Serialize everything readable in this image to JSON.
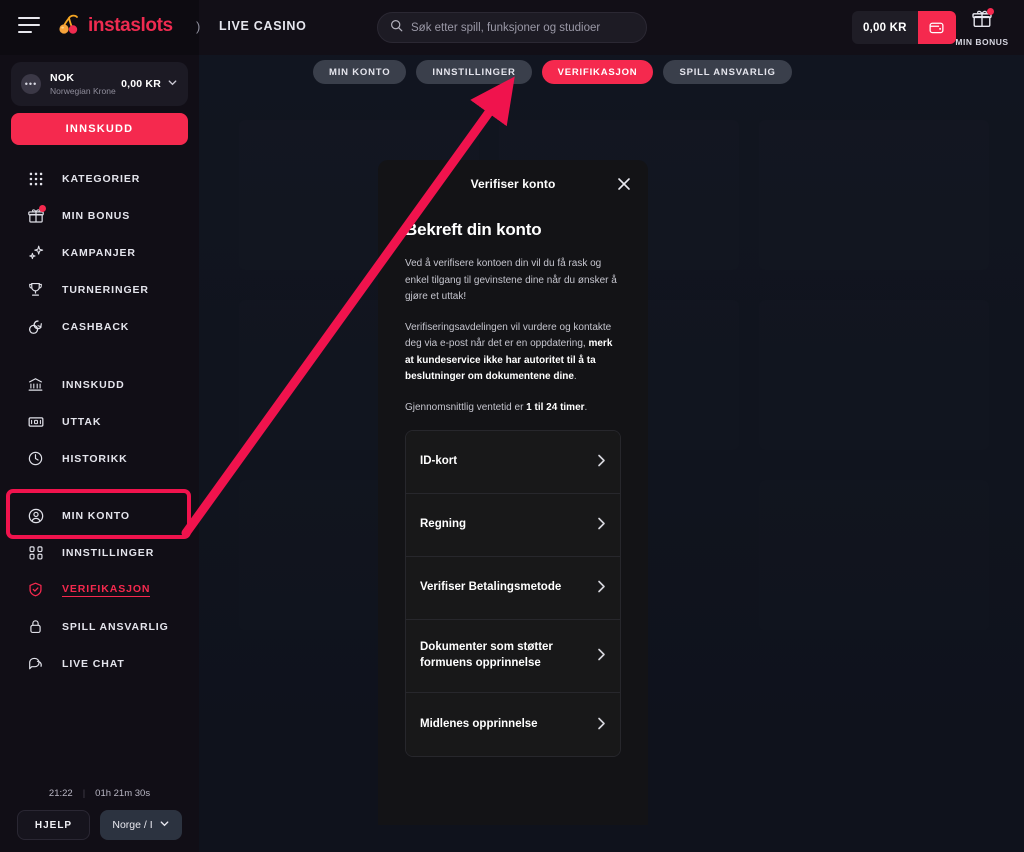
{
  "brand": {
    "name": "instaslots",
    "accent": "#f5294e"
  },
  "topbar": {
    "nav_cut_glyph": ")",
    "live_casino_label": "LIVE CASINO",
    "search": {
      "placeholder": "Søk etter spill, funksjoner og studioer",
      "value": "",
      "icon": "search-icon"
    },
    "balance": {
      "amount": "0,00 KR",
      "wallet_icon": "wallet-icon"
    },
    "bonus": {
      "label": "MIN BONUS",
      "icon": "gift-icon",
      "has_notification": true
    }
  },
  "sidebar": {
    "currency": {
      "code": "NOK",
      "name": "Norwegian Krone",
      "amount": "0,00 KR",
      "chevron": "chevron-down-icon"
    },
    "deposit_label": "INNSKUDD",
    "group1": [
      {
        "label": "KATEGORIER",
        "icon": "grid-icon"
      },
      {
        "label": "MIN BONUS",
        "icon": "gift-icon",
        "badge": true
      },
      {
        "label": "KAMPANJER",
        "icon": "sparkles-icon"
      },
      {
        "label": "TURNERINGER",
        "icon": "trophy-icon"
      },
      {
        "label": "CASHBACK",
        "icon": "cashback-icon"
      }
    ],
    "group2": [
      {
        "label": "INNSKUDD",
        "icon": "bank-icon"
      },
      {
        "label": "UTTAK",
        "icon": "banknote-icon"
      },
      {
        "label": "HISTORIKK",
        "icon": "clock-icon"
      }
    ],
    "group3": [
      {
        "label": "MIN KONTO",
        "icon": "user-circle-icon",
        "highlighted": true
      },
      {
        "label": "INNSTILLINGER",
        "icon": "sliders-icon"
      },
      {
        "label": "VERIFIKASJON",
        "icon": "shield-check-icon",
        "active": true
      },
      {
        "label": "SPILL ANSVARLIG",
        "icon": "lock-icon"
      },
      {
        "label": "LIVE CHAT",
        "icon": "chat-icon"
      }
    ],
    "footer": {
      "clock": "21:22",
      "session": "01h 21m 30s",
      "help_label": "HJELP",
      "language_label": "Norge / I",
      "language_chevron": "chevron-down-icon"
    }
  },
  "tabs": [
    {
      "label": "MIN KONTO",
      "active": false
    },
    {
      "label": "INNSTILLINGER",
      "active": false
    },
    {
      "label": "VERIFIKASJON",
      "active": true
    },
    {
      "label": "SPILL ANSVARLIG",
      "active": false
    }
  ],
  "modal": {
    "title": "Verifiser konto",
    "close_icon": "close-icon",
    "heading": "Bekreft din konto",
    "paragraph1": "Ved å verifisere kontoen din vil du få rask og enkel tilgang til gevinstene dine når du ønsker å gjøre et uttak!",
    "paragraph2_pre": "Verifiseringsavdelingen vil vurdere og kontakte deg via e-post når det er en oppdatering, ",
    "paragraph2_bold": "merk at kundeservice ikke har autoritet til å ta beslutninger om dokumentene dine",
    "paragraph2_post": ".",
    "paragraph3_pre": "Gjennomsnittlig ventetid er ",
    "paragraph3_bold": "1 til 24 timer",
    "paragraph3_post": ".",
    "documents": [
      {
        "label": "ID-kort",
        "chevron": "chevron-right-icon"
      },
      {
        "label": "Regning",
        "chevron": "chevron-right-icon"
      },
      {
        "label": "Verifiser Betalingsmetode",
        "chevron": "chevron-right-icon"
      },
      {
        "label": "Dokumenter som støtter formuens opprinnelse",
        "chevron": "chevron-right-icon"
      },
      {
        "label": "Midlenes opprinnelse",
        "chevron": "chevron-right-icon"
      }
    ]
  },
  "annotations": {
    "arrow_color": "#f0134d",
    "box_color": "#f0134d",
    "arrow_target": "VERIFIKASJON",
    "box_target": "MIN KONTO"
  }
}
